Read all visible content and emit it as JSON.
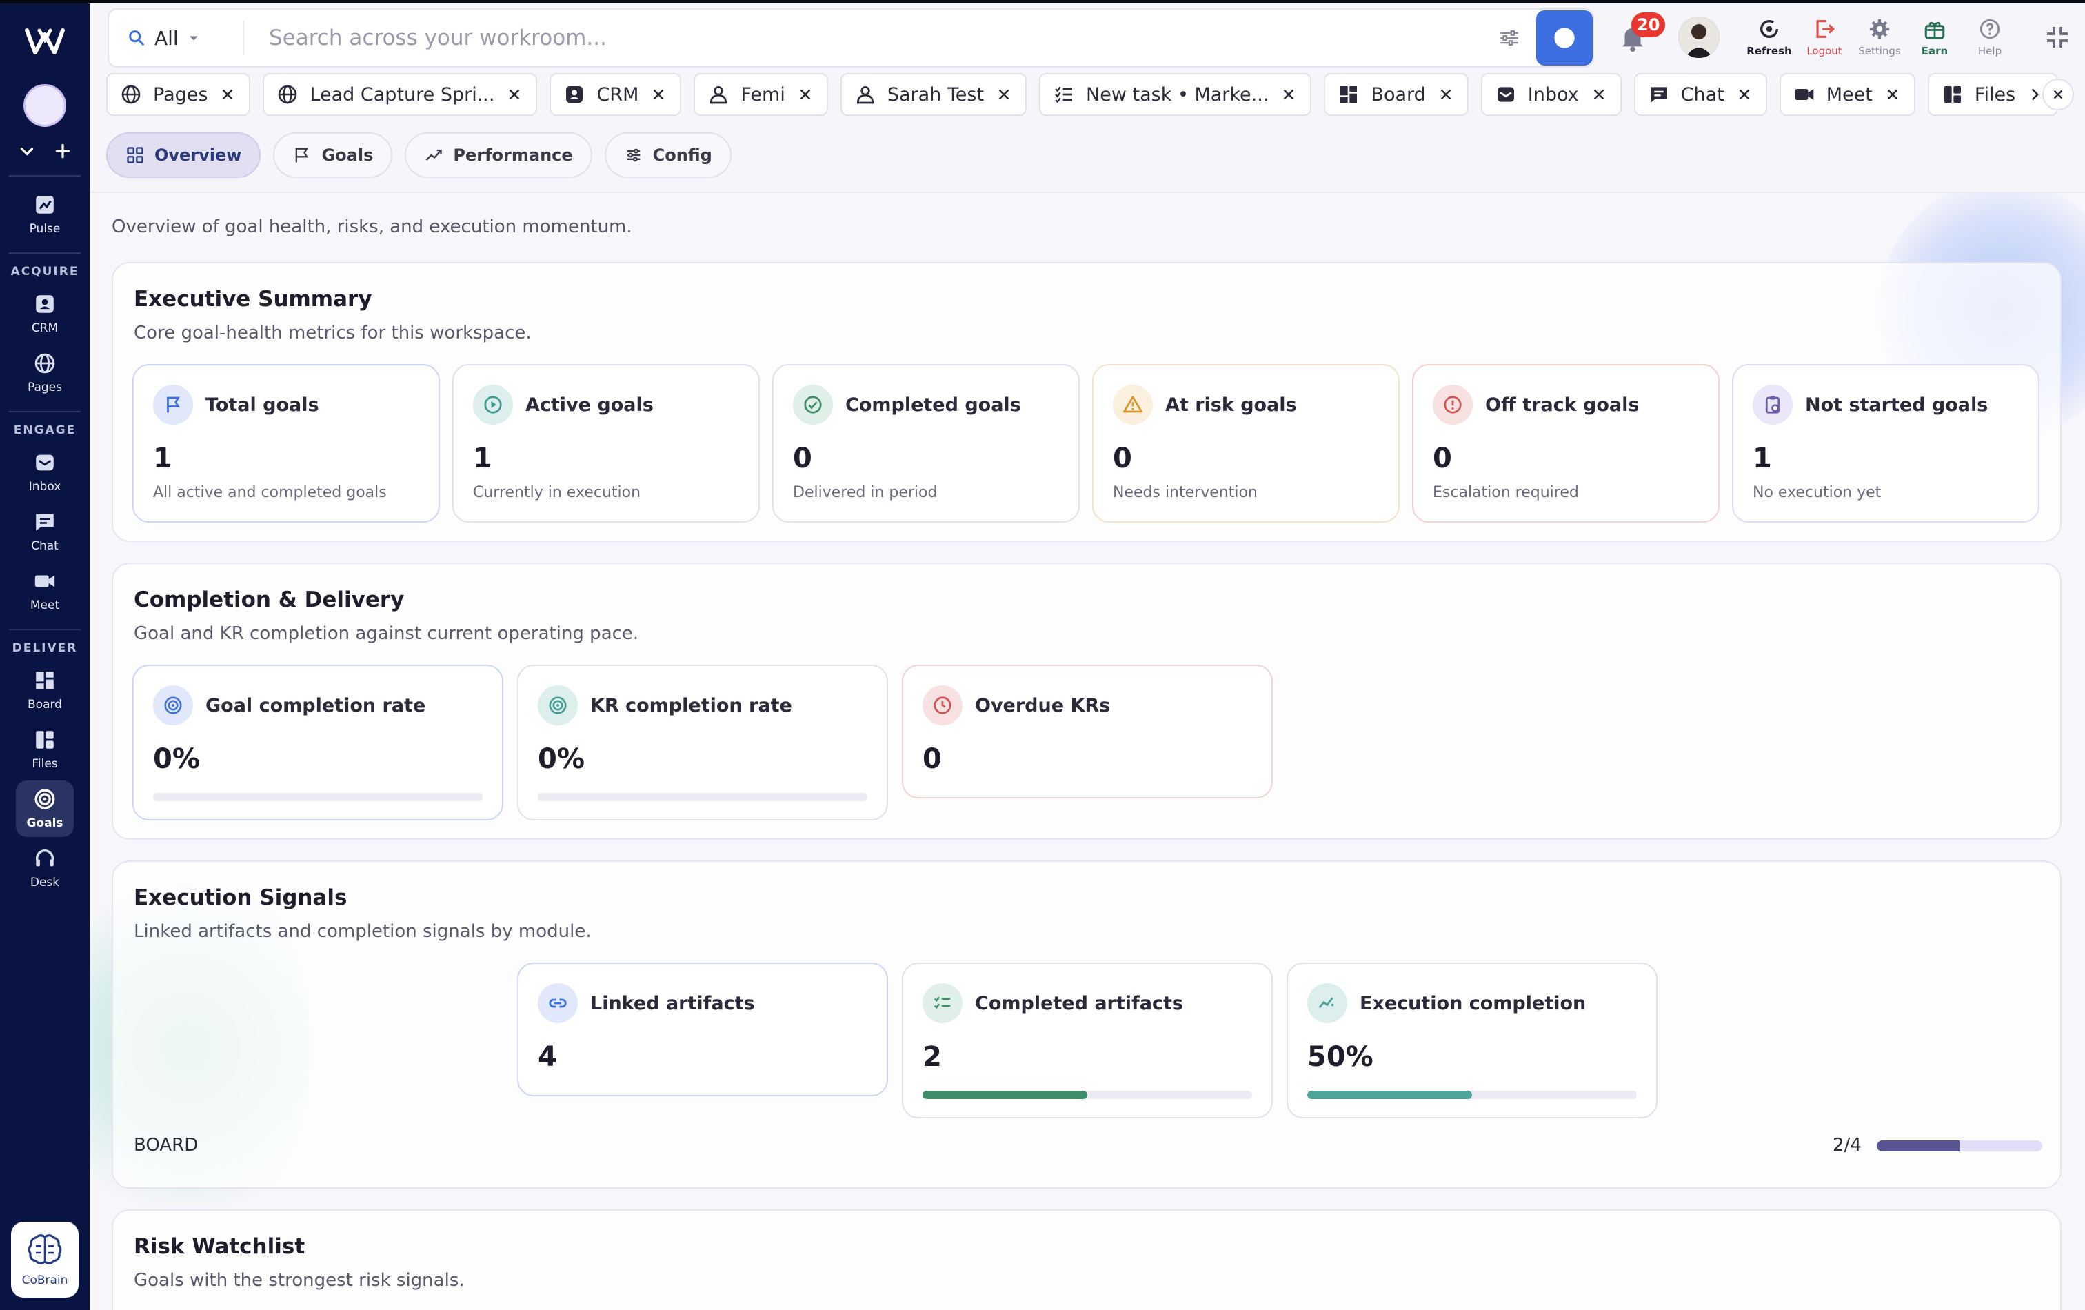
{
  "sidebar": {
    "items_top": [
      {
        "label": "Pulse",
        "icon": "chart-icon"
      }
    ],
    "sections": [
      {
        "title": "ACQUIRE",
        "items": [
          {
            "label": "CRM",
            "icon": "crm-icon"
          },
          {
            "label": "Pages",
            "icon": "globe-icon"
          }
        ]
      },
      {
        "title": "ENGAGE",
        "items": [
          {
            "label": "Inbox",
            "icon": "inbox-icon"
          },
          {
            "label": "Chat",
            "icon": "chat-icon"
          },
          {
            "label": "Meet",
            "icon": "video-icon"
          }
        ]
      },
      {
        "title": "DELIVER",
        "items": [
          {
            "label": "Board",
            "icon": "board-icon"
          },
          {
            "label": "Files",
            "icon": "files-icon"
          },
          {
            "label": "Goals",
            "icon": "target-icon",
            "active": true
          },
          {
            "label": "Desk",
            "icon": "headset-icon"
          }
        ]
      }
    ],
    "cobrain_label": "CoBrain"
  },
  "search": {
    "scope": "All",
    "placeholder": "Search across your workroom..."
  },
  "notifications": {
    "count": "20"
  },
  "top_actions": [
    {
      "label": "Refresh",
      "icon": "refresh-icon"
    },
    {
      "label": "Logout",
      "icon": "logout-icon"
    },
    {
      "label": "Settings",
      "icon": "gear-icon"
    },
    {
      "label": "Earn",
      "icon": "gift-icon"
    },
    {
      "label": "Help",
      "icon": "help-icon"
    }
  ],
  "tabs": [
    {
      "label": "Pages",
      "icon": "globe-icon"
    },
    {
      "label": "Lead Capture Spri...",
      "icon": "globe-icon"
    },
    {
      "label": "CRM",
      "icon": "crm-icon"
    },
    {
      "label": "Femi",
      "icon": "person-icon"
    },
    {
      "label": "Sarah Test",
      "icon": "person-icon"
    },
    {
      "label": "New task • Marke...",
      "icon": "tasklist-icon"
    },
    {
      "label": "Board",
      "icon": "board-icon"
    },
    {
      "label": "Inbox",
      "icon": "inbox-icon"
    },
    {
      "label": "Chat",
      "icon": "chat-icon"
    },
    {
      "label": "Meet",
      "icon": "video-icon"
    },
    {
      "label": "Files",
      "icon": "files-icon"
    }
  ],
  "module_tabs": [
    {
      "label": "Overview",
      "icon": "grid-icon",
      "active": true
    },
    {
      "label": "Goals",
      "icon": "flag-icon"
    },
    {
      "label": "Performance",
      "icon": "trend-icon"
    },
    {
      "label": "Config",
      "icon": "sliders-icon"
    }
  ],
  "page": {
    "description": "Overview of goal health, risks, and execution momentum."
  },
  "executive_summary": {
    "title": "Executive Summary",
    "subtitle": "Core goal-health metrics for this workspace.",
    "cards": [
      {
        "title": "Total goals",
        "value": "1",
        "sub": "All active and completed goals",
        "icon": "flag-icon"
      },
      {
        "title": "Active goals",
        "value": "1",
        "sub": "Currently in execution",
        "icon": "play-icon"
      },
      {
        "title": "Completed goals",
        "value": "0",
        "sub": "Delivered in period",
        "icon": "check-circle-icon"
      },
      {
        "title": "At risk goals",
        "value": "0",
        "sub": "Needs intervention",
        "icon": "warning-icon"
      },
      {
        "title": "Off track goals",
        "value": "0",
        "sub": "Escalation required",
        "icon": "alert-circle-icon"
      },
      {
        "title": "Not started goals",
        "value": "1",
        "sub": "No execution yet",
        "icon": "clipboard-icon"
      }
    ]
  },
  "completion": {
    "title": "Completion & Delivery",
    "subtitle": "Goal and KR completion against current operating pace.",
    "cards": [
      {
        "title": "Goal completion rate",
        "value": "0%",
        "progress": 0,
        "icon": "target-icon"
      },
      {
        "title": "KR completion rate",
        "value": "0%",
        "progress": 0,
        "icon": "target-icon"
      },
      {
        "title": "Overdue KRs",
        "value": "0",
        "icon": "clock-icon"
      }
    ]
  },
  "execution": {
    "title": "Execution Signals",
    "subtitle": "Linked artifacts and completion signals by module.",
    "cards": [
      {
        "title": "Linked artifacts",
        "value": "4",
        "icon": "link-icon"
      },
      {
        "title": "Completed artifacts",
        "value": "2",
        "progress": 0.5,
        "icon": "checklist-icon"
      },
      {
        "title": "Execution completion",
        "value": "50%",
        "progress": 0.5,
        "icon": "sparkline-icon"
      }
    ],
    "module": {
      "label": "BOARD",
      "count": "2/4",
      "progress": 0.5
    }
  },
  "risk": {
    "title": "Risk Watchlist",
    "subtitle": "Goals with the strongest risk signals."
  },
  "colors": {
    "sidebar_bg": "#0a1442",
    "accent_blue": "#3d6fe0",
    "green": "#3f8e6a",
    "teal": "#4fa49a",
    "purple": "#5b5493"
  }
}
